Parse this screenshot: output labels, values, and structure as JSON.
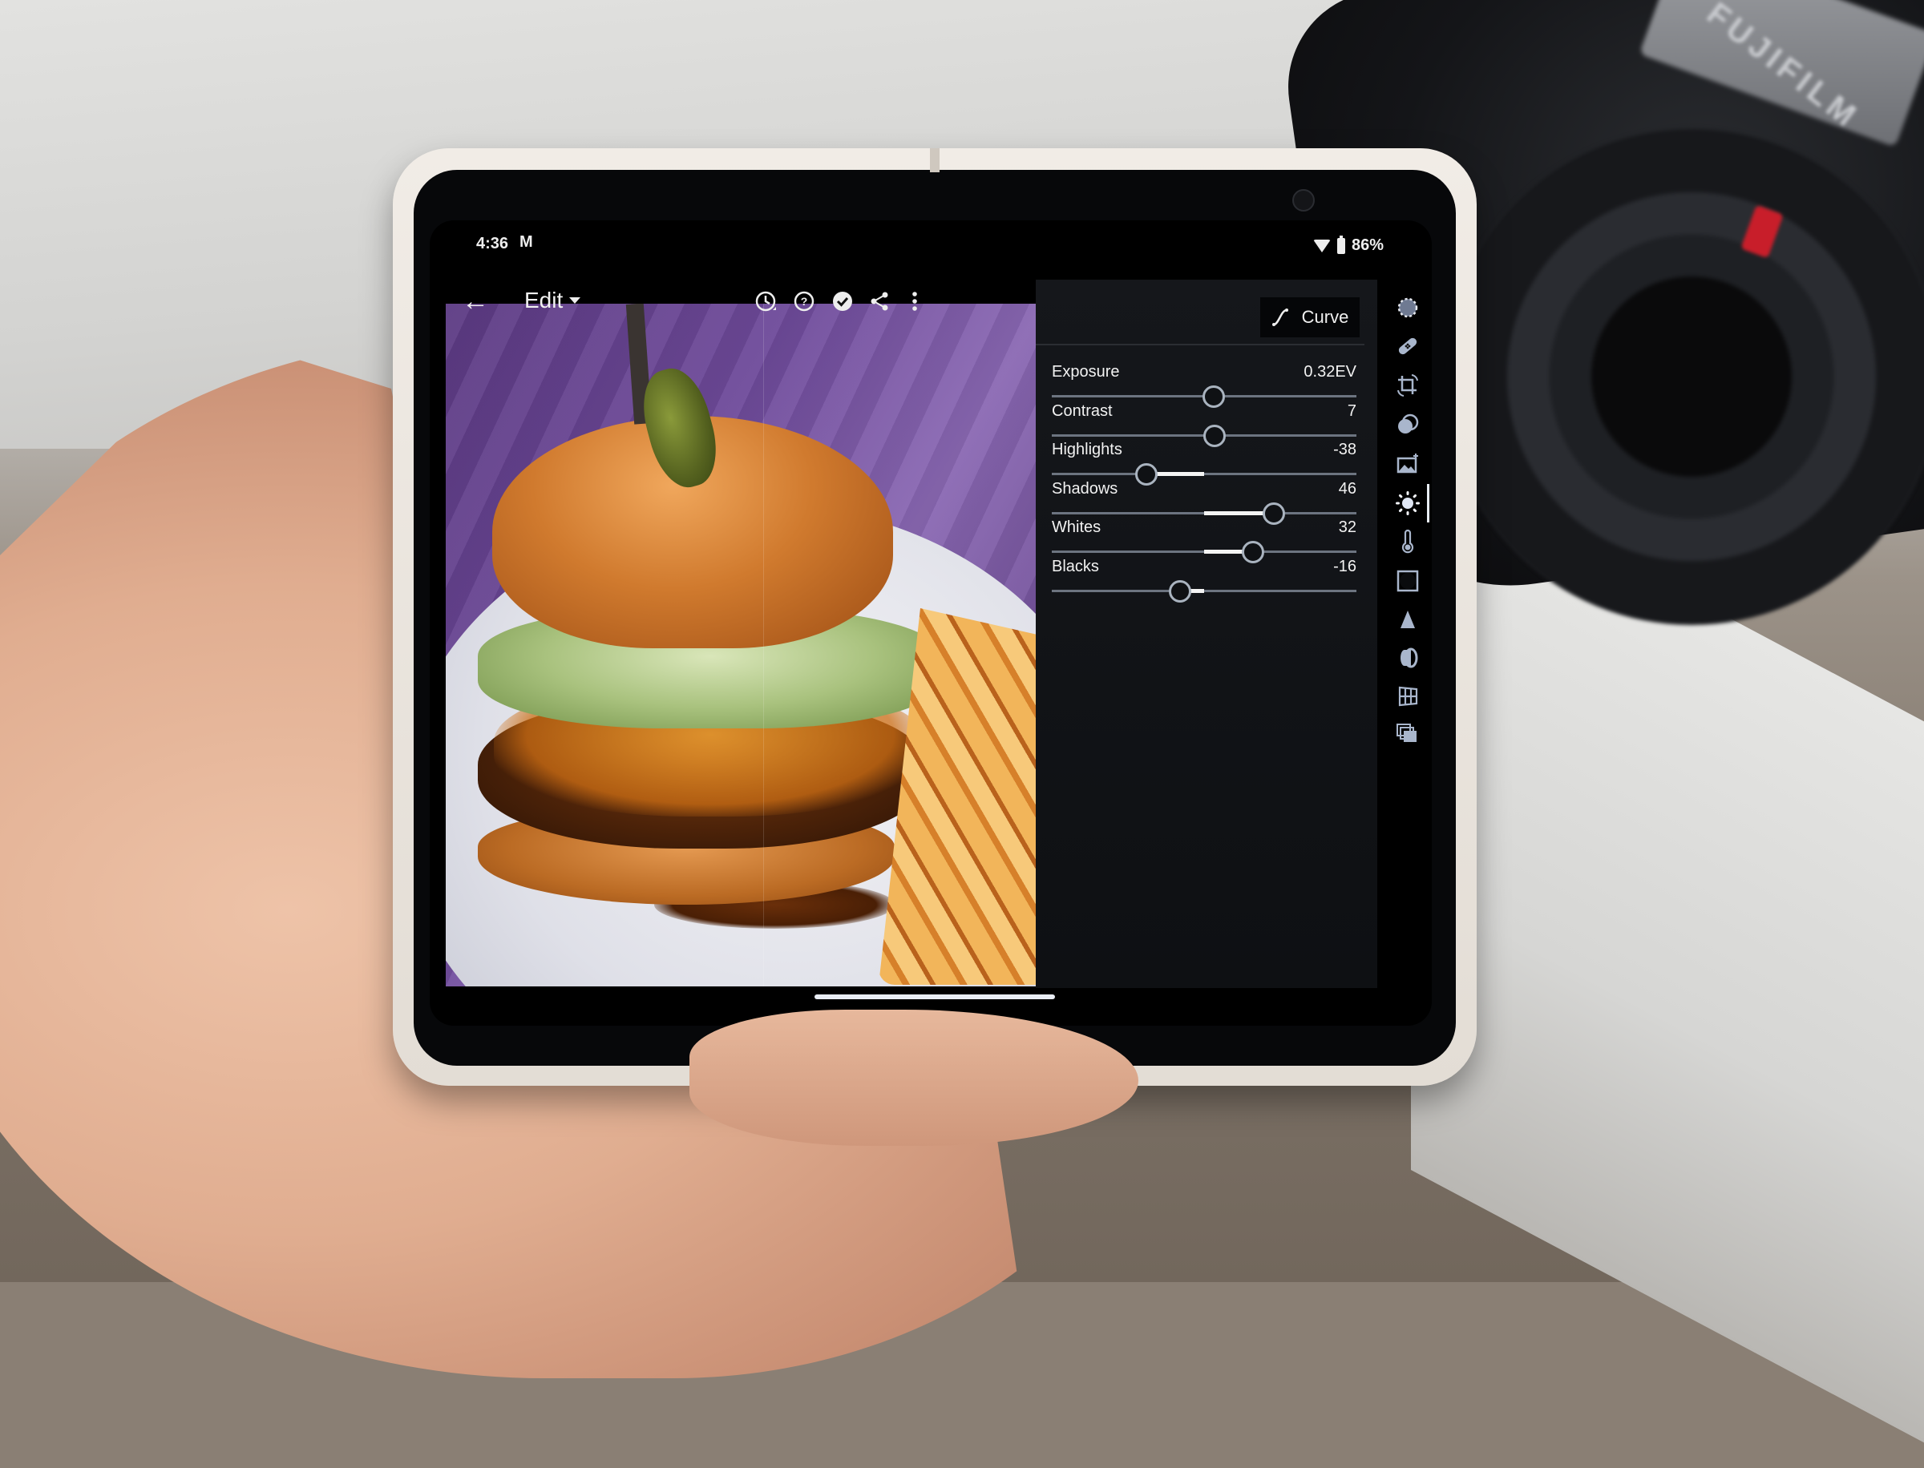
{
  "status_bar": {
    "time": "4:36",
    "notification_icon": "gmail-icon",
    "notification_glyph": "M",
    "wifi_icon": "wifi-icon",
    "battery_icon": "battery-icon",
    "battery_level": "86%"
  },
  "toolbar": {
    "back_icon": "arrow-left-icon",
    "back_glyph": "←",
    "mode_label": "Edit",
    "mode_caret_icon": "caret-down-icon",
    "actions": [
      {
        "name": "history-icon"
      },
      {
        "name": "help-icon"
      },
      {
        "name": "done-check-icon"
      },
      {
        "name": "share-icon"
      },
      {
        "name": "more-vert-icon"
      }
    ]
  },
  "panel": {
    "curve_button_label": "Curve",
    "curve_icon": "curve-icon",
    "sliders": [
      {
        "label": "Exposure",
        "value": "0.32EV",
        "min": -5,
        "max": 5,
        "numeric": 0.32
      },
      {
        "label": "Contrast",
        "value": "7",
        "min": -100,
        "max": 100,
        "numeric": 7
      },
      {
        "label": "Highlights",
        "value": "-38",
        "min": -100,
        "max": 100,
        "numeric": -38
      },
      {
        "label": "Shadows",
        "value": "46",
        "min": -100,
        "max": 100,
        "numeric": 46
      },
      {
        "label": "Whites",
        "value": "32",
        "min": -100,
        "max": 100,
        "numeric": 32
      },
      {
        "label": "Blacks",
        "value": "-16",
        "min": -100,
        "max": 100,
        "numeric": -16
      }
    ]
  },
  "tool_rail": {
    "active_tool": "light",
    "tools": [
      {
        "id": "presets",
        "icon": "presets-dotted-circle-icon"
      },
      {
        "id": "healing",
        "icon": "bandage-icon"
      },
      {
        "id": "crop",
        "icon": "crop-rotate-icon"
      },
      {
        "id": "masking",
        "icon": "masking-icon"
      },
      {
        "id": "auto",
        "icon": "auto-enhance-image-icon"
      },
      {
        "id": "light",
        "icon": "sun-icon"
      },
      {
        "id": "color",
        "icon": "thermometer-icon"
      },
      {
        "id": "effects",
        "icon": "vignette-icon"
      },
      {
        "id": "detail",
        "icon": "triangle-detail-icon"
      },
      {
        "id": "optics",
        "icon": "lens-icon"
      },
      {
        "id": "geometry",
        "icon": "geometry-grid-icon"
      },
      {
        "id": "versions",
        "icon": "versions-stack-icon"
      }
    ]
  },
  "scene": {
    "camera_brand": "FUJIFILM"
  }
}
